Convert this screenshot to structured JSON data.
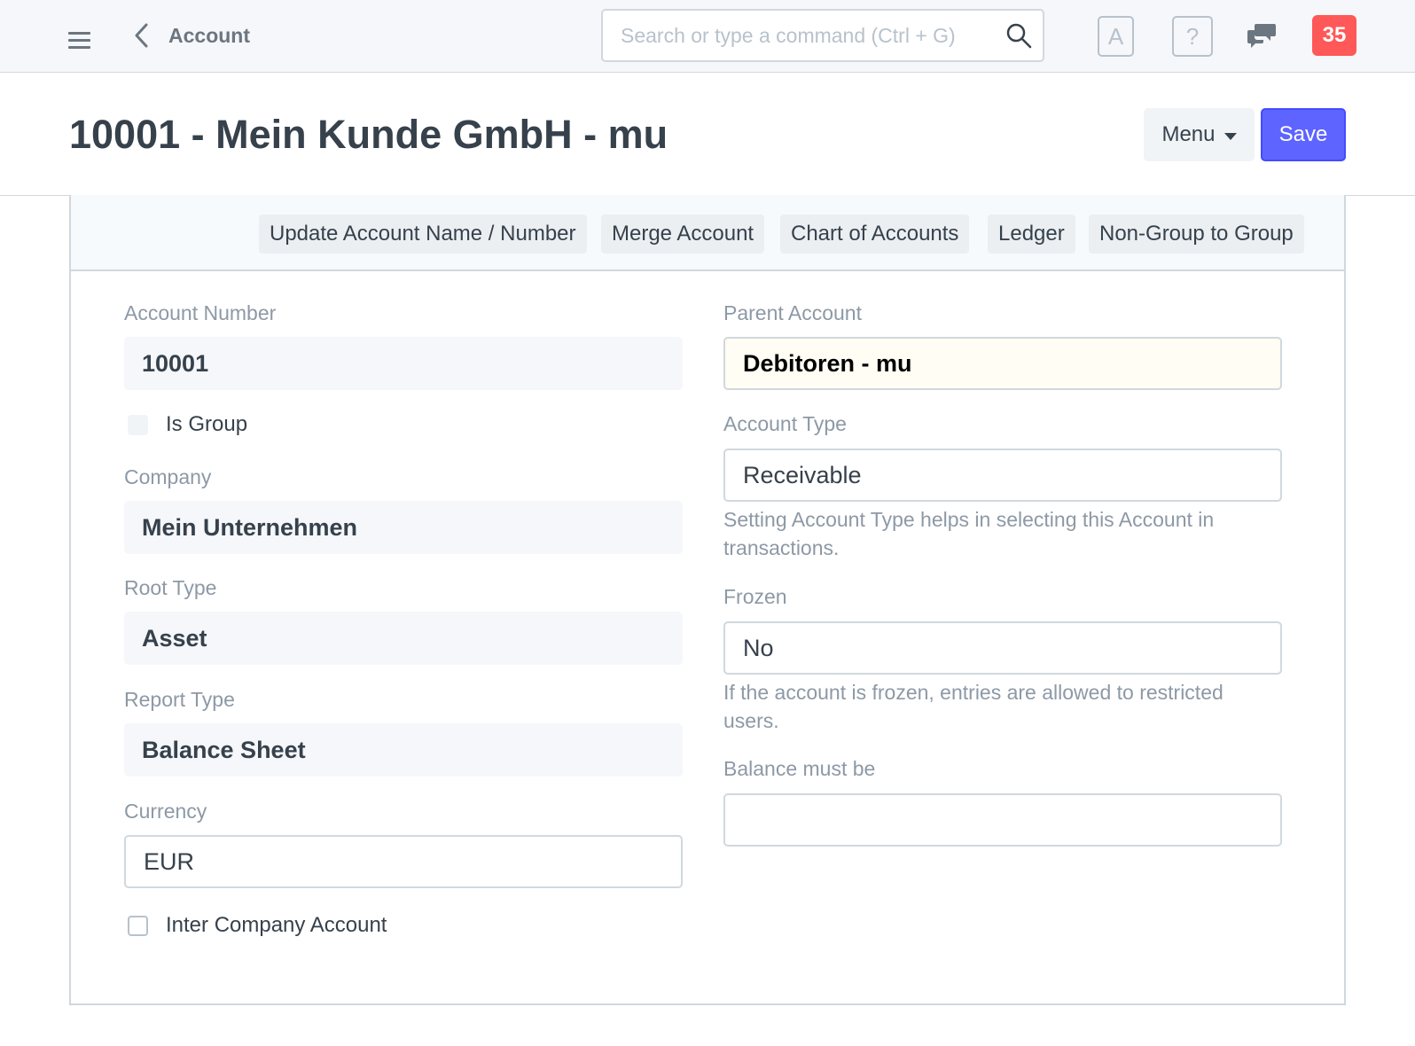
{
  "navbar": {
    "title": "Account",
    "search_placeholder": "Search or type a command (Ctrl + G)",
    "avatar_letter": "A",
    "help_glyph": "?",
    "notification_count": "35"
  },
  "page": {
    "title": "10001 - Mein Kunde GmbH - mu",
    "menu_label": "Menu",
    "save_label": "Save"
  },
  "toolbar": {
    "buttons": [
      "Update Account Name / Number",
      "Merge Account",
      "Chart of Accounts",
      "Ledger",
      "Non-Group to Group"
    ]
  },
  "form": {
    "account_number": {
      "label": "Account Number",
      "value": "10001"
    },
    "is_group": {
      "label": "Is Group",
      "checked": false
    },
    "company": {
      "label": "Company",
      "value": "Mein Unternehmen"
    },
    "root_type": {
      "label": "Root Type",
      "value": "Asset"
    },
    "report_type": {
      "label": "Report Type",
      "value": "Balance Sheet"
    },
    "currency": {
      "label": "Currency",
      "value": "EUR"
    },
    "inter_company": {
      "label": "Inter Company Account",
      "checked": false
    },
    "parent_account": {
      "label": "Parent Account",
      "value": "Debitoren - mu"
    },
    "account_type": {
      "label": "Account Type",
      "value": "Receivable",
      "help": "Setting Account Type helps in selecting this Account in transactions."
    },
    "frozen": {
      "label": "Frozen",
      "value": "No",
      "help": "If the account is frozen, entries are allowed to restricted users."
    },
    "balance_must_be": {
      "label": "Balance must be",
      "value": ""
    }
  },
  "colors": {
    "primary": "#5e64ff",
    "badge": "#ff5858",
    "link_field_bg": "#fffdf4"
  },
  "icons": {
    "menu": "hamburger-icon",
    "back": "chevron-left-icon",
    "search": "search-icon",
    "chat": "chat-bubbles-icon",
    "caret": "caret-down-icon"
  }
}
